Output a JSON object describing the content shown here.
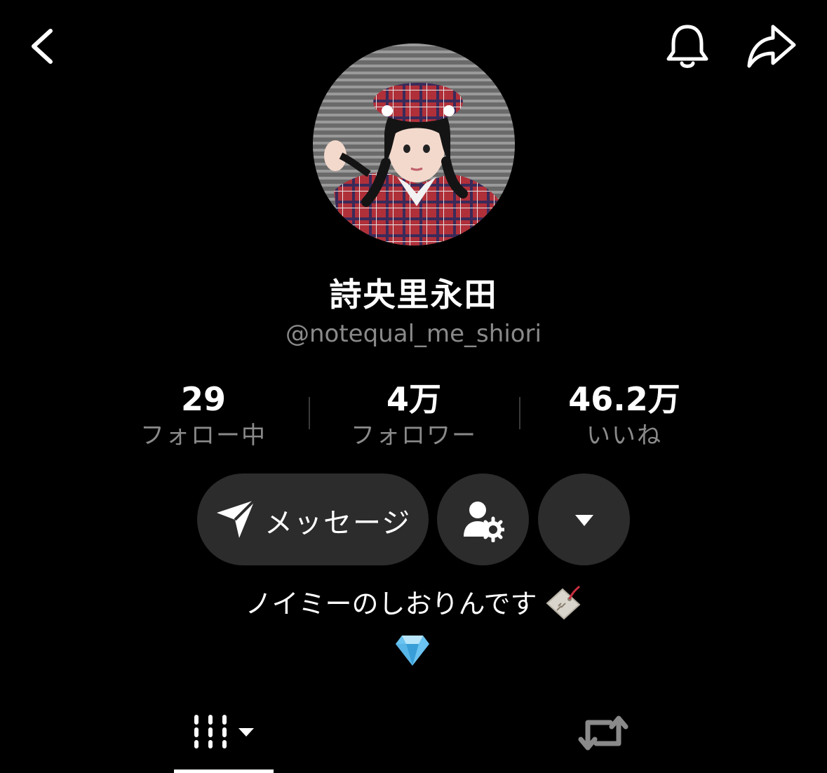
{
  "header": {
    "back_icon": "chevron-left-icon",
    "bell_icon": "bell-icon",
    "share_icon": "share-arrow-icon"
  },
  "profile": {
    "display_name": "詩央里永田",
    "username": "@notequal_me_shiori"
  },
  "stats": [
    {
      "value": "29",
      "label": "フォロー中"
    },
    {
      "value": "4万",
      "label": "フォロワー"
    },
    {
      "value": "46.2万",
      "label": "いいね"
    }
  ],
  "actions": {
    "message_label": "メッセージ",
    "message_icon": "send-icon",
    "settings_icon": "person-gear-icon",
    "more_icon": "caret-down-icon"
  },
  "bio": {
    "line1": "ノイミーのしおりんです",
    "line1_emoji": "tag-emoji",
    "line2_emoji": "diamond-emoji"
  },
  "tabs": [
    {
      "name": "videos",
      "icon": "grid-bars-icon",
      "active": true
    },
    {
      "name": "reposts",
      "icon": "repost-icon",
      "active": false
    }
  ],
  "colors": {
    "background": "#000000",
    "button_bg": "#2c2c2c",
    "secondary_text": "#8a8a8a"
  }
}
